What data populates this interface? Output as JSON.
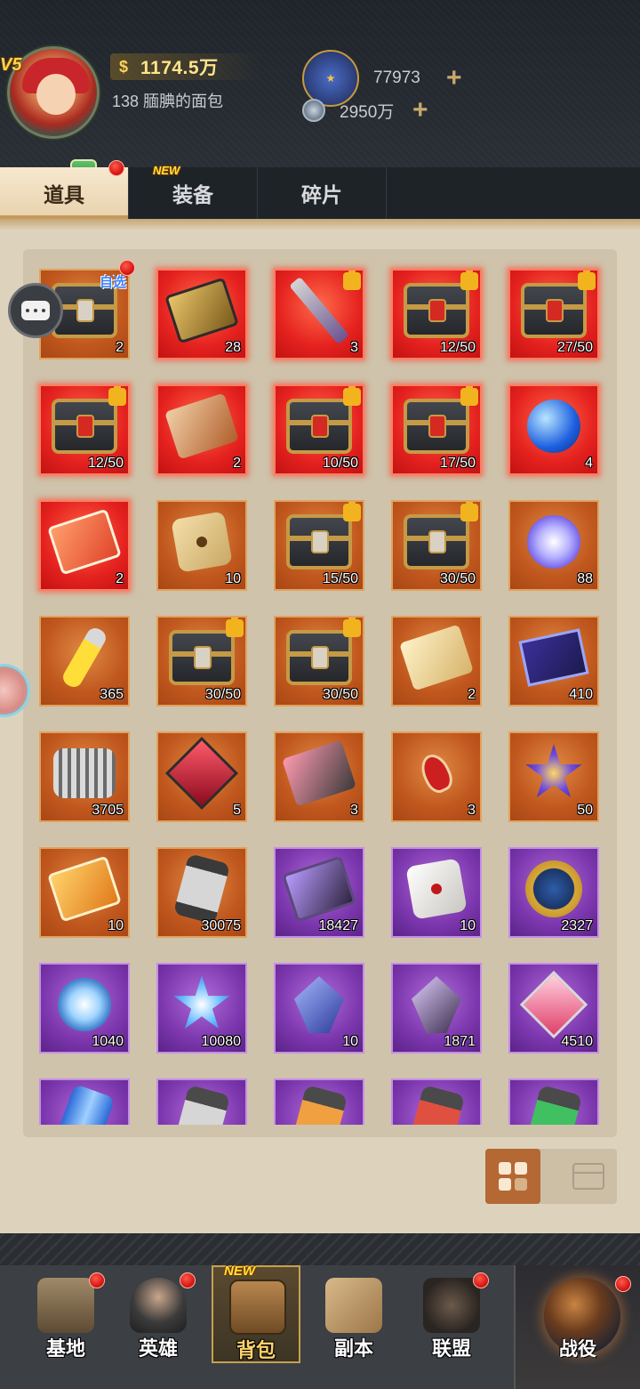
{
  "player": {
    "vip_level": "V5",
    "vip_badge": "V5",
    "power": "1174.5万",
    "nickname": "138 腼腆的面包"
  },
  "resources": [
    {
      "name": "medal",
      "icon": "medal-icon",
      "value": "77973"
    },
    {
      "name": "steel",
      "icon": "steel-icon",
      "value": "2950万"
    }
  ],
  "tabs": [
    {
      "label": "道具",
      "active": true,
      "red_dot": true
    },
    {
      "label": "装备",
      "new": "NEW"
    },
    {
      "label": "碎片"
    }
  ],
  "items": [
    {
      "rarity": "orange",
      "art": "chest",
      "count": "2",
      "tag": "自选",
      "red_dot": true
    },
    {
      "rarity": "red",
      "art": "card-gold",
      "count": "28"
    },
    {
      "rarity": "red",
      "art": "blade",
      "count": "3",
      "puzzle": true
    },
    {
      "rarity": "red",
      "art": "chest-red",
      "count": "12/50",
      "puzzle": true
    },
    {
      "rarity": "red",
      "art": "chest-red",
      "count": "27/50",
      "puzzle": true
    },
    {
      "rarity": "red",
      "art": "chest-red",
      "count": "12/50",
      "puzzle": true
    },
    {
      "rarity": "red",
      "art": "ticket",
      "count": "2"
    },
    {
      "rarity": "red",
      "art": "chest-red",
      "count": "10/50",
      "puzzle": true
    },
    {
      "rarity": "red",
      "art": "chest-red",
      "count": "17/50",
      "puzzle": true
    },
    {
      "rarity": "red",
      "art": "potion-blue",
      "count": "4"
    },
    {
      "rarity": "red",
      "art": "card-red",
      "count": "2"
    },
    {
      "rarity": "orange",
      "art": "dice",
      "count": "10"
    },
    {
      "rarity": "orange",
      "art": "chest",
      "count": "15/50",
      "puzzle": true
    },
    {
      "rarity": "orange",
      "art": "chest",
      "count": "30/50",
      "puzzle": true
    },
    {
      "rarity": "orange",
      "art": "star-crystal",
      "count": "88"
    },
    {
      "rarity": "orange",
      "art": "vial",
      "count": "365"
    },
    {
      "rarity": "orange",
      "art": "chest",
      "count": "30/50",
      "puzzle": true
    },
    {
      "rarity": "orange",
      "art": "chest",
      "count": "30/50",
      "puzzle": true
    },
    {
      "rarity": "orange",
      "art": "ticket-gold",
      "count": "2"
    },
    {
      "rarity": "orange",
      "art": "book",
      "count": "410"
    },
    {
      "rarity": "orange",
      "art": "engine",
      "count": "3705"
    },
    {
      "rarity": "orange",
      "art": "cube-red",
      "count": "5"
    },
    {
      "rarity": "orange",
      "art": "chip",
      "count": "3"
    },
    {
      "rarity": "orange",
      "art": "key",
      "count": "3"
    },
    {
      "rarity": "orange",
      "art": "flower-crystal",
      "count": "50"
    },
    {
      "rarity": "orange",
      "art": "card-orange",
      "count": "10"
    },
    {
      "rarity": "orange",
      "art": "canister",
      "count": "30075"
    },
    {
      "rarity": "purple",
      "art": "chip-purple",
      "count": "18427"
    },
    {
      "rarity": "purple",
      "art": "dice-white",
      "count": "10"
    },
    {
      "rarity": "purple",
      "art": "medal",
      "count": "2327"
    },
    {
      "rarity": "purple",
      "art": "snowflake",
      "count": "1040"
    },
    {
      "rarity": "purple",
      "art": "star-blue",
      "count": "10080"
    },
    {
      "rarity": "purple",
      "art": "crystal-blue",
      "count": "10"
    },
    {
      "rarity": "purple",
      "art": "crystal-dark",
      "count": "1871"
    },
    {
      "rarity": "purple",
      "art": "gem-pink",
      "count": "4510"
    },
    {
      "rarity": "purple",
      "art": "can-blue",
      "count": ""
    },
    {
      "rarity": "purple",
      "art": "canister-gray",
      "count": ""
    },
    {
      "rarity": "purple",
      "art": "canister-orange",
      "count": ""
    },
    {
      "rarity": "purple",
      "art": "canister-red",
      "count": ""
    },
    {
      "rarity": "purple",
      "art": "canister-green",
      "count": ""
    }
  ],
  "bottom_nav": [
    {
      "label": "基地",
      "icon": "base-icon",
      "red_dot": true
    },
    {
      "label": "英雄",
      "icon": "hero-icon",
      "red_dot": true
    },
    {
      "label": "背包",
      "icon": "backpack-icon",
      "active": true,
      "new": "NEW"
    },
    {
      "label": "副本",
      "icon": "map-icon"
    },
    {
      "label": "联盟",
      "icon": "alliance-icon",
      "red_dot": true
    },
    {
      "label": "战役",
      "icon": "campaign-icon",
      "red_dot": true
    }
  ],
  "colors": {
    "orange": "#c0571e",
    "red": "#e5221f",
    "purple": "#7c37ae",
    "accent_gold": "#ffe48a"
  }
}
